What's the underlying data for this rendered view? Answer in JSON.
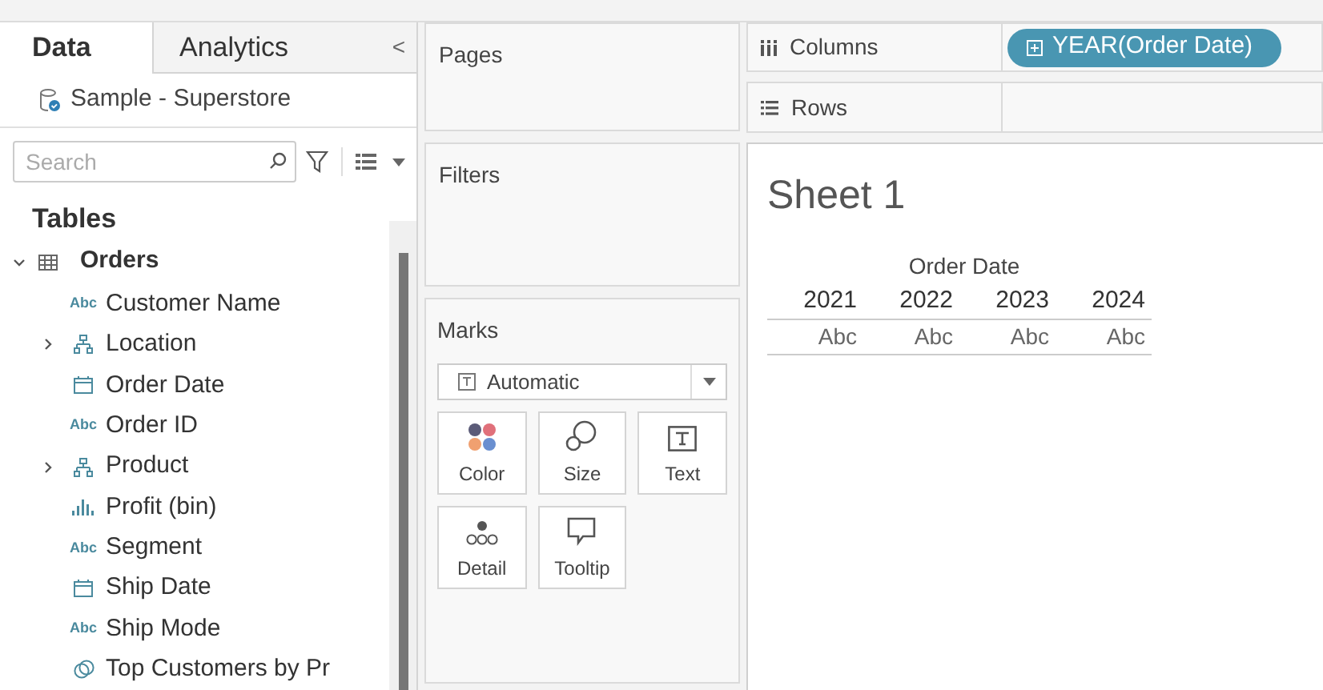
{
  "tabs": [
    {
      "label": "Data",
      "selected": true
    },
    {
      "label": "Analytics",
      "selected": false
    }
  ],
  "collapse": "<",
  "data_source": "Sample - Superstore",
  "search": {
    "placeholder": "Search"
  },
  "tables_heading": "Tables",
  "table": {
    "name": "Orders",
    "expanded": true,
    "fields": [
      {
        "name": "Customer Name",
        "kind": "text",
        "type_label": "Abc"
      },
      {
        "name": "Location",
        "kind": "hierarchy",
        "expanded": false
      },
      {
        "name": "Order Date",
        "kind": "date"
      },
      {
        "name": "Order ID",
        "kind": "text",
        "type_label": "Abc"
      },
      {
        "name": "Product",
        "kind": "hierarchy",
        "expanded": false
      },
      {
        "name": "Profit (bin)",
        "kind": "bin"
      },
      {
        "name": "Segment",
        "kind": "text",
        "type_label": "Abc"
      },
      {
        "name": "Ship Date",
        "kind": "date"
      },
      {
        "name": "Ship Mode",
        "kind": "text",
        "type_label": "Abc"
      },
      {
        "name": "Top Customers by Pr",
        "kind": "set"
      }
    ]
  },
  "pages": {
    "title": "Pages"
  },
  "filters": {
    "title": "Filters"
  },
  "marks": {
    "title": "Marks",
    "mark_type": "Automatic",
    "cards": [
      {
        "label": "Color",
        "kind": "color"
      },
      {
        "label": "Size",
        "kind": "size"
      },
      {
        "label": "Text",
        "kind": "text"
      },
      {
        "label": "Detail",
        "kind": "detail"
      },
      {
        "label": "Tooltip",
        "kind": "tooltip"
      }
    ]
  },
  "columns": {
    "label": "Columns",
    "pills": [
      "YEAR(Order Date)"
    ]
  },
  "rows": {
    "label": "Rows"
  },
  "sheet": {
    "title": "Sheet 1",
    "header": "Order Date",
    "years": [
      "2021",
      "2022",
      "2023",
      "2024"
    ],
    "cells": [
      "Abc",
      "Abc",
      "Abc",
      "Abc"
    ]
  }
}
